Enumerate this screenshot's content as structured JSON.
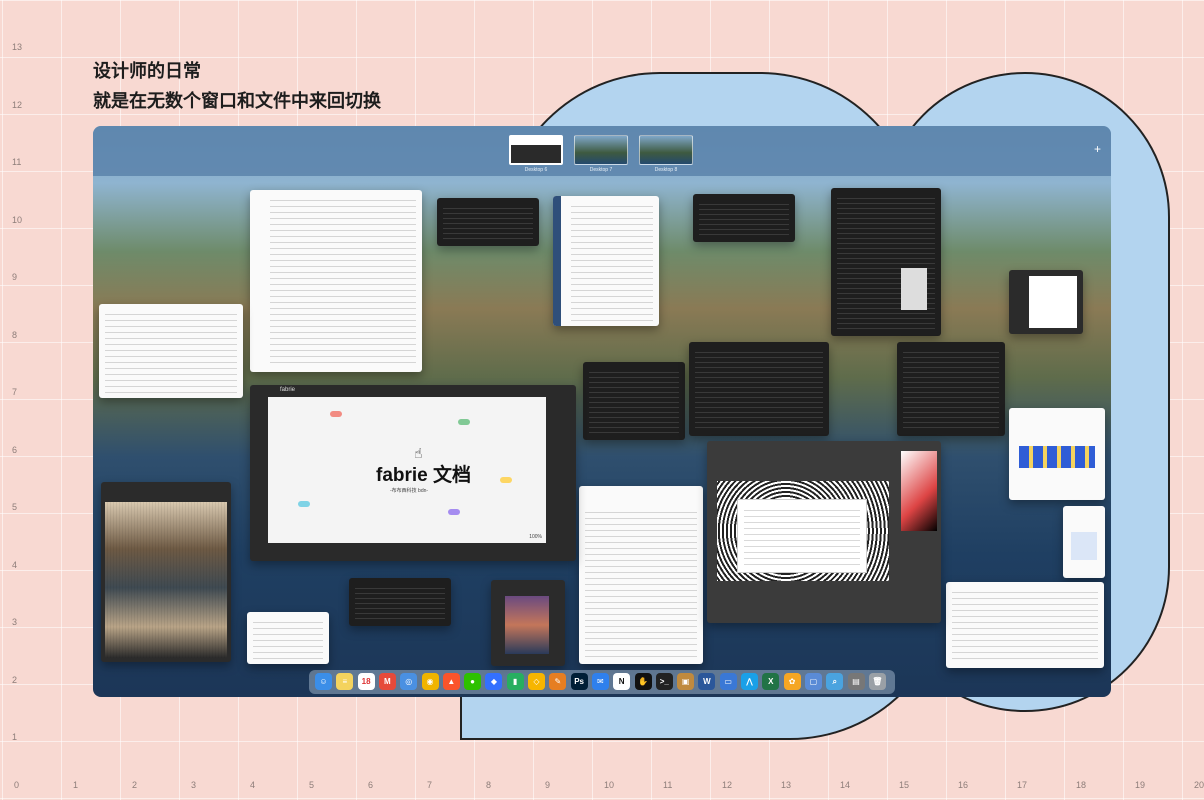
{
  "headline": {
    "line1": "设计师的日常",
    "line2": "就是在无数个窗口和文件中来回切换"
  },
  "axis": {
    "x_labels": [
      "0",
      "1",
      "2",
      "3",
      "4",
      "5",
      "6",
      "7",
      "8",
      "9",
      "10",
      "11",
      "12",
      "13",
      "14",
      "15",
      "16",
      "17",
      "18",
      "19",
      "20"
    ],
    "y_labels": [
      "13",
      "12",
      "11",
      "10",
      "9",
      "8",
      "7",
      "6",
      "5",
      "4",
      "3",
      "2",
      "1"
    ]
  },
  "mission_control": {
    "spaces": [
      {
        "label": "Desktop 6",
        "active": true
      },
      {
        "label": "Desktop 7",
        "active": false
      },
      {
        "label": "Desktop 8",
        "active": false
      }
    ],
    "add_space": "+"
  },
  "fabrie_window": {
    "top_brand": "fabrie",
    "brand": "fabrie 文档",
    "subtitle": "-布布西科技 bdn-",
    "zoom": "100%"
  },
  "dock": {
    "icons": [
      {
        "name": "finder-icon",
        "color": "#3b8ee8",
        "glyph": "☺"
      },
      {
        "name": "notes-icon",
        "color": "#f4d35e",
        "glyph": "≡"
      },
      {
        "name": "calendar-icon",
        "color": "#ffffff",
        "glyph": "18",
        "fg": "#d33"
      },
      {
        "name": "gmail-icon",
        "color": "#e64a3a",
        "glyph": "M"
      },
      {
        "name": "safari-icon",
        "color": "#4a90e2",
        "glyph": "◎"
      },
      {
        "name": "chrome-icon",
        "color": "#f0b400",
        "glyph": "◉"
      },
      {
        "name": "brave-icon",
        "color": "#fb542b",
        "glyph": "▲"
      },
      {
        "name": "wechat-icon",
        "color": "#2dc100",
        "glyph": "●"
      },
      {
        "name": "feishu-icon",
        "color": "#3370ff",
        "glyph": "◆"
      },
      {
        "name": "numbers-icon",
        "color": "#27ae60",
        "glyph": "▮"
      },
      {
        "name": "sketch-icon",
        "color": "#f7b500",
        "glyph": "◇"
      },
      {
        "name": "pen-icon",
        "color": "#e67e22",
        "glyph": "✎"
      },
      {
        "name": "photoshop-icon",
        "color": "#001e36",
        "glyph": "Ps"
      },
      {
        "name": "mail-icon",
        "color": "#2f80ed",
        "glyph": "✉"
      },
      {
        "name": "notion-icon",
        "color": "#ffffff",
        "glyph": "N",
        "fg": "#111"
      },
      {
        "name": "fabrie-icon",
        "color": "#111111",
        "glyph": "✋"
      },
      {
        "name": "terminal-icon",
        "color": "#222222",
        "glyph": ">_"
      },
      {
        "name": "preview-icon",
        "color": "#c08a3e",
        "glyph": "▣"
      },
      {
        "name": "word-icon",
        "color": "#2b579a",
        "glyph": "W"
      },
      {
        "name": "keynote-icon",
        "color": "#3a78d6",
        "glyph": "▭"
      },
      {
        "name": "lanhu-icon",
        "color": "#1aa0e8",
        "glyph": "⋀"
      },
      {
        "name": "excel-icon",
        "color": "#217346",
        "glyph": "X"
      },
      {
        "name": "photos-icon",
        "color": "#f5a623",
        "glyph": "✿"
      },
      {
        "name": "screen-icon",
        "color": "#5a8bd6",
        "glyph": "▢"
      },
      {
        "name": "search-icon",
        "color": "#4aa3df",
        "glyph": "⌕"
      },
      {
        "name": "image-capture-icon",
        "color": "#777777",
        "glyph": "▤"
      },
      {
        "name": "trash-icon",
        "color": "#9aa0a6",
        "glyph": "🗑"
      }
    ]
  }
}
